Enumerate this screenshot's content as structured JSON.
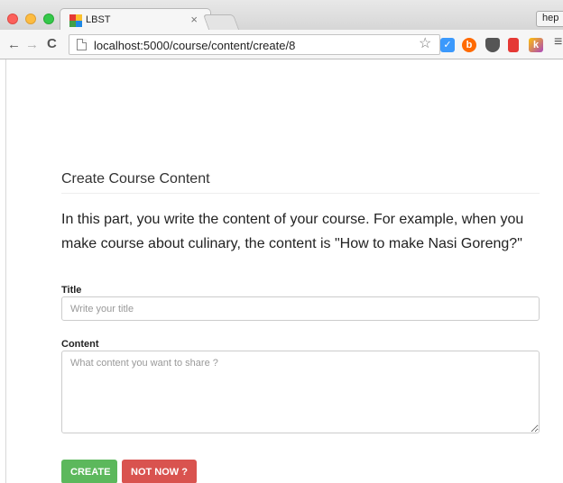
{
  "browser": {
    "tab_title": "LBST",
    "tab_close": "×",
    "profile_label": "hep",
    "url": "localhost:5000/course/content/create/8",
    "back": "←",
    "forward": "→",
    "reload": "C",
    "bookmark": "☆",
    "menu": "≡",
    "extensions": {
      "check": "✓",
      "b": "b",
      "k": "k"
    },
    "icons": [
      "close-dot",
      "minimize-dot",
      "maximize-dot",
      "page-icon",
      "star-icon",
      "pocket-icon",
      "flag-icon",
      "menu-icon"
    ]
  },
  "page": {
    "heading": "Create Course Content",
    "intro": "In this part, you write the content of your course. For example, when you make course about culinary, the content is \"How to make Nasi Goreng?\"",
    "form": {
      "title_label": "Title",
      "title_placeholder": "Write your title",
      "content_label": "Content",
      "content_placeholder": "What content you want to share ?"
    },
    "buttons": {
      "create": "CREATE",
      "not_now": "NOT NOW ?"
    }
  },
  "colors": {
    "create_button": "#5cb85c",
    "not_now_button": "#d9534f"
  }
}
